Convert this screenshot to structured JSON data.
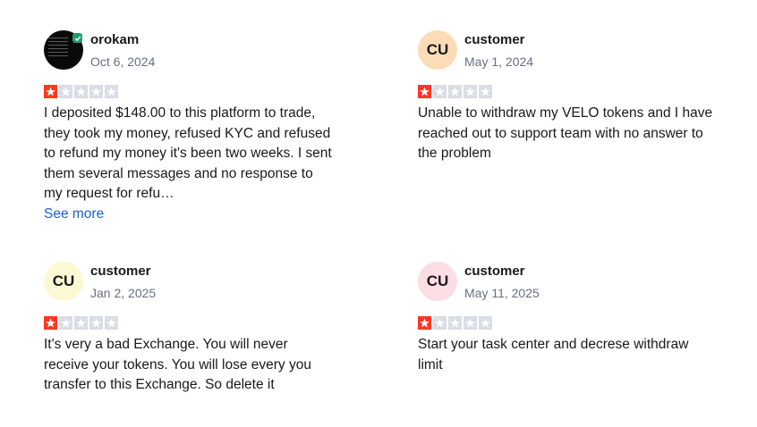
{
  "reviews": [
    {
      "author": "orokam",
      "date": "Oct 6, 2024",
      "avatar_initials": "",
      "avatar_type": "photo",
      "verified_icon": "check-badge-icon",
      "rating": 1,
      "text": "I deposited $148.00 to this platform to trade, they took my money, refused KYC and refused to refund my money it's been two weeks. I sent them several messages and no response to my request for refu…",
      "see_more": "See more"
    },
    {
      "author": "customer",
      "date": "May 1, 2024",
      "avatar_initials": "CU",
      "avatar_color": "#fcdcb6",
      "rating": 1,
      "text": "Unable to withdraw my VELO tokens and I have reached out to support team with no answer to the problem"
    },
    {
      "author": "customer",
      "date": "Jan 2, 2025",
      "avatar_initials": "CU",
      "avatar_color": "#fdf8d4",
      "rating": 1,
      "text": "It's very a bad Exchange. You will never receive your tokens. You will lose every you transfer to this Exchange. So delete it"
    },
    {
      "author": "customer",
      "date": "May 11, 2025",
      "avatar_initials": "CU",
      "avatar_color": "#fbdde4",
      "rating": 1,
      "text": "Start your task center and decrese withdraw limit"
    }
  ],
  "colors": {
    "star_filled": "#ff3722",
    "star_empty": "#dcdce6",
    "link": "#1c5fd4",
    "date": "#6c6c85",
    "verified": "#1e9e6a"
  }
}
